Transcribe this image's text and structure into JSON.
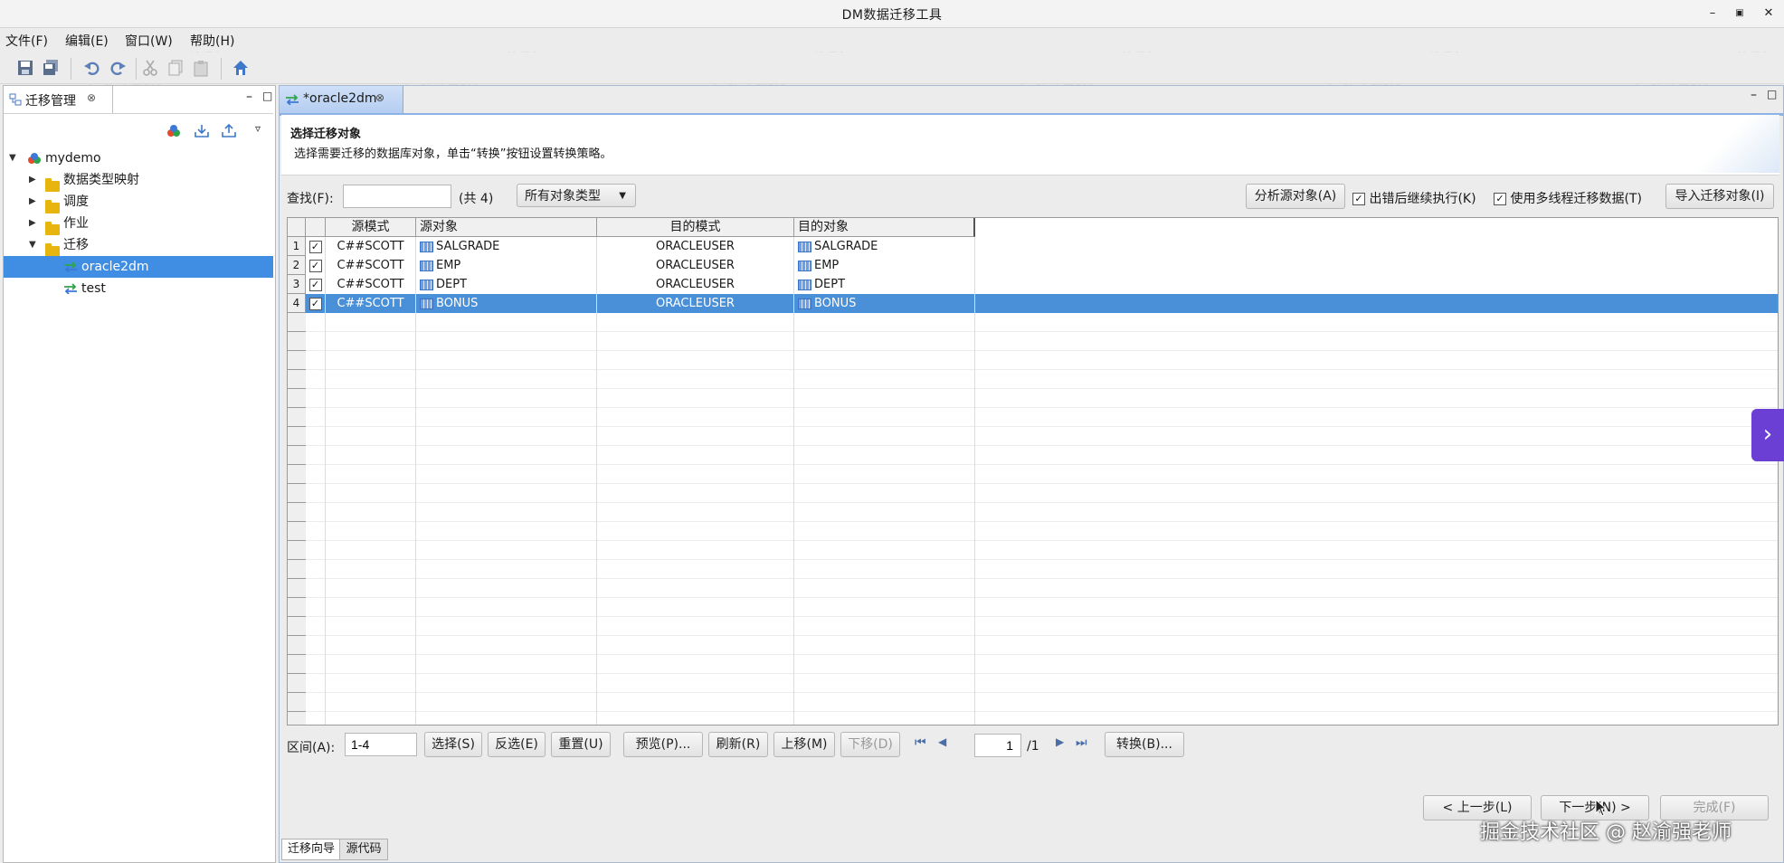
{
  "window": {
    "title": "DM数据迁移工具"
  },
  "menu": [
    "文件(F)",
    "编辑(E)",
    "窗口(W)",
    "帮助(H)"
  ],
  "left_panel": {
    "tab_label": "迁移管理",
    "tree": {
      "root": "mydemo",
      "children": [
        "数据类型映射",
        "调度",
        "作业",
        "迁移"
      ],
      "migration_items": [
        "oracle2dm",
        "test"
      ]
    }
  },
  "editor": {
    "tab_label": "*oracle2dm",
    "header_title": "选择迁移对象",
    "header_desc": "选择需要迁移的数据库对象，单击“转换”按钮设置转换策略。",
    "search_label": "查找(F):",
    "search_value": "",
    "count_label": "(共 4)",
    "type_select": "所有对象类型",
    "analyze_button": "分析源对象(A)",
    "continue_on_error": "出错后继续执行(K)",
    "multithread": "使用多线程迁移数据(T)",
    "import_button": "导入迁移对象(I)",
    "columns": [
      "源模式",
      "源对象",
      "目的模式",
      "目的对象"
    ],
    "rows": [
      {
        "num": "1",
        "src_schema": "C##SCOTT",
        "src_obj": "SALGRADE",
        "dst_schema": "ORACLEUSER",
        "dst_obj": "SALGRADE"
      },
      {
        "num": "2",
        "src_schema": "C##SCOTT",
        "src_obj": "EMP",
        "dst_schema": "ORACLEUSER",
        "dst_obj": "EMP"
      },
      {
        "num": "3",
        "src_schema": "C##SCOTT",
        "src_obj": "DEPT",
        "dst_schema": "ORACLEUSER",
        "dst_obj": "DEPT"
      },
      {
        "num": "4",
        "src_schema": "C##SCOTT",
        "src_obj": "BONUS",
        "dst_schema": "ORACLEUSER",
        "dst_obj": "BONUS"
      }
    ],
    "range_label": "区间(A):",
    "range_value": "1-4",
    "buttons": {
      "select": "选择(S)",
      "invert": "反选(E)",
      "reset": "重置(U)",
      "preview": "预览(P)...",
      "refresh": "刷新(R)",
      "up": "上移(M)",
      "down": "下移(D)",
      "convert": "转换(B)..."
    },
    "page_value": "1",
    "page_total": "/1",
    "wizard": {
      "prev": "< 上一步(L)",
      "next": "下一步(N) >",
      "finish": "完成(F)"
    },
    "bottom_tabs": [
      "迁移向导",
      "源代码"
    ]
  },
  "overlay": {
    "credit": "掘金技术社区 @ 赵渝强老师",
    "watermark": "赵渝强老师"
  },
  "colors": {
    "selection": "#4a90d9",
    "tree_selection": "#3f8ee3",
    "side_tab": "#6b3fd4"
  }
}
